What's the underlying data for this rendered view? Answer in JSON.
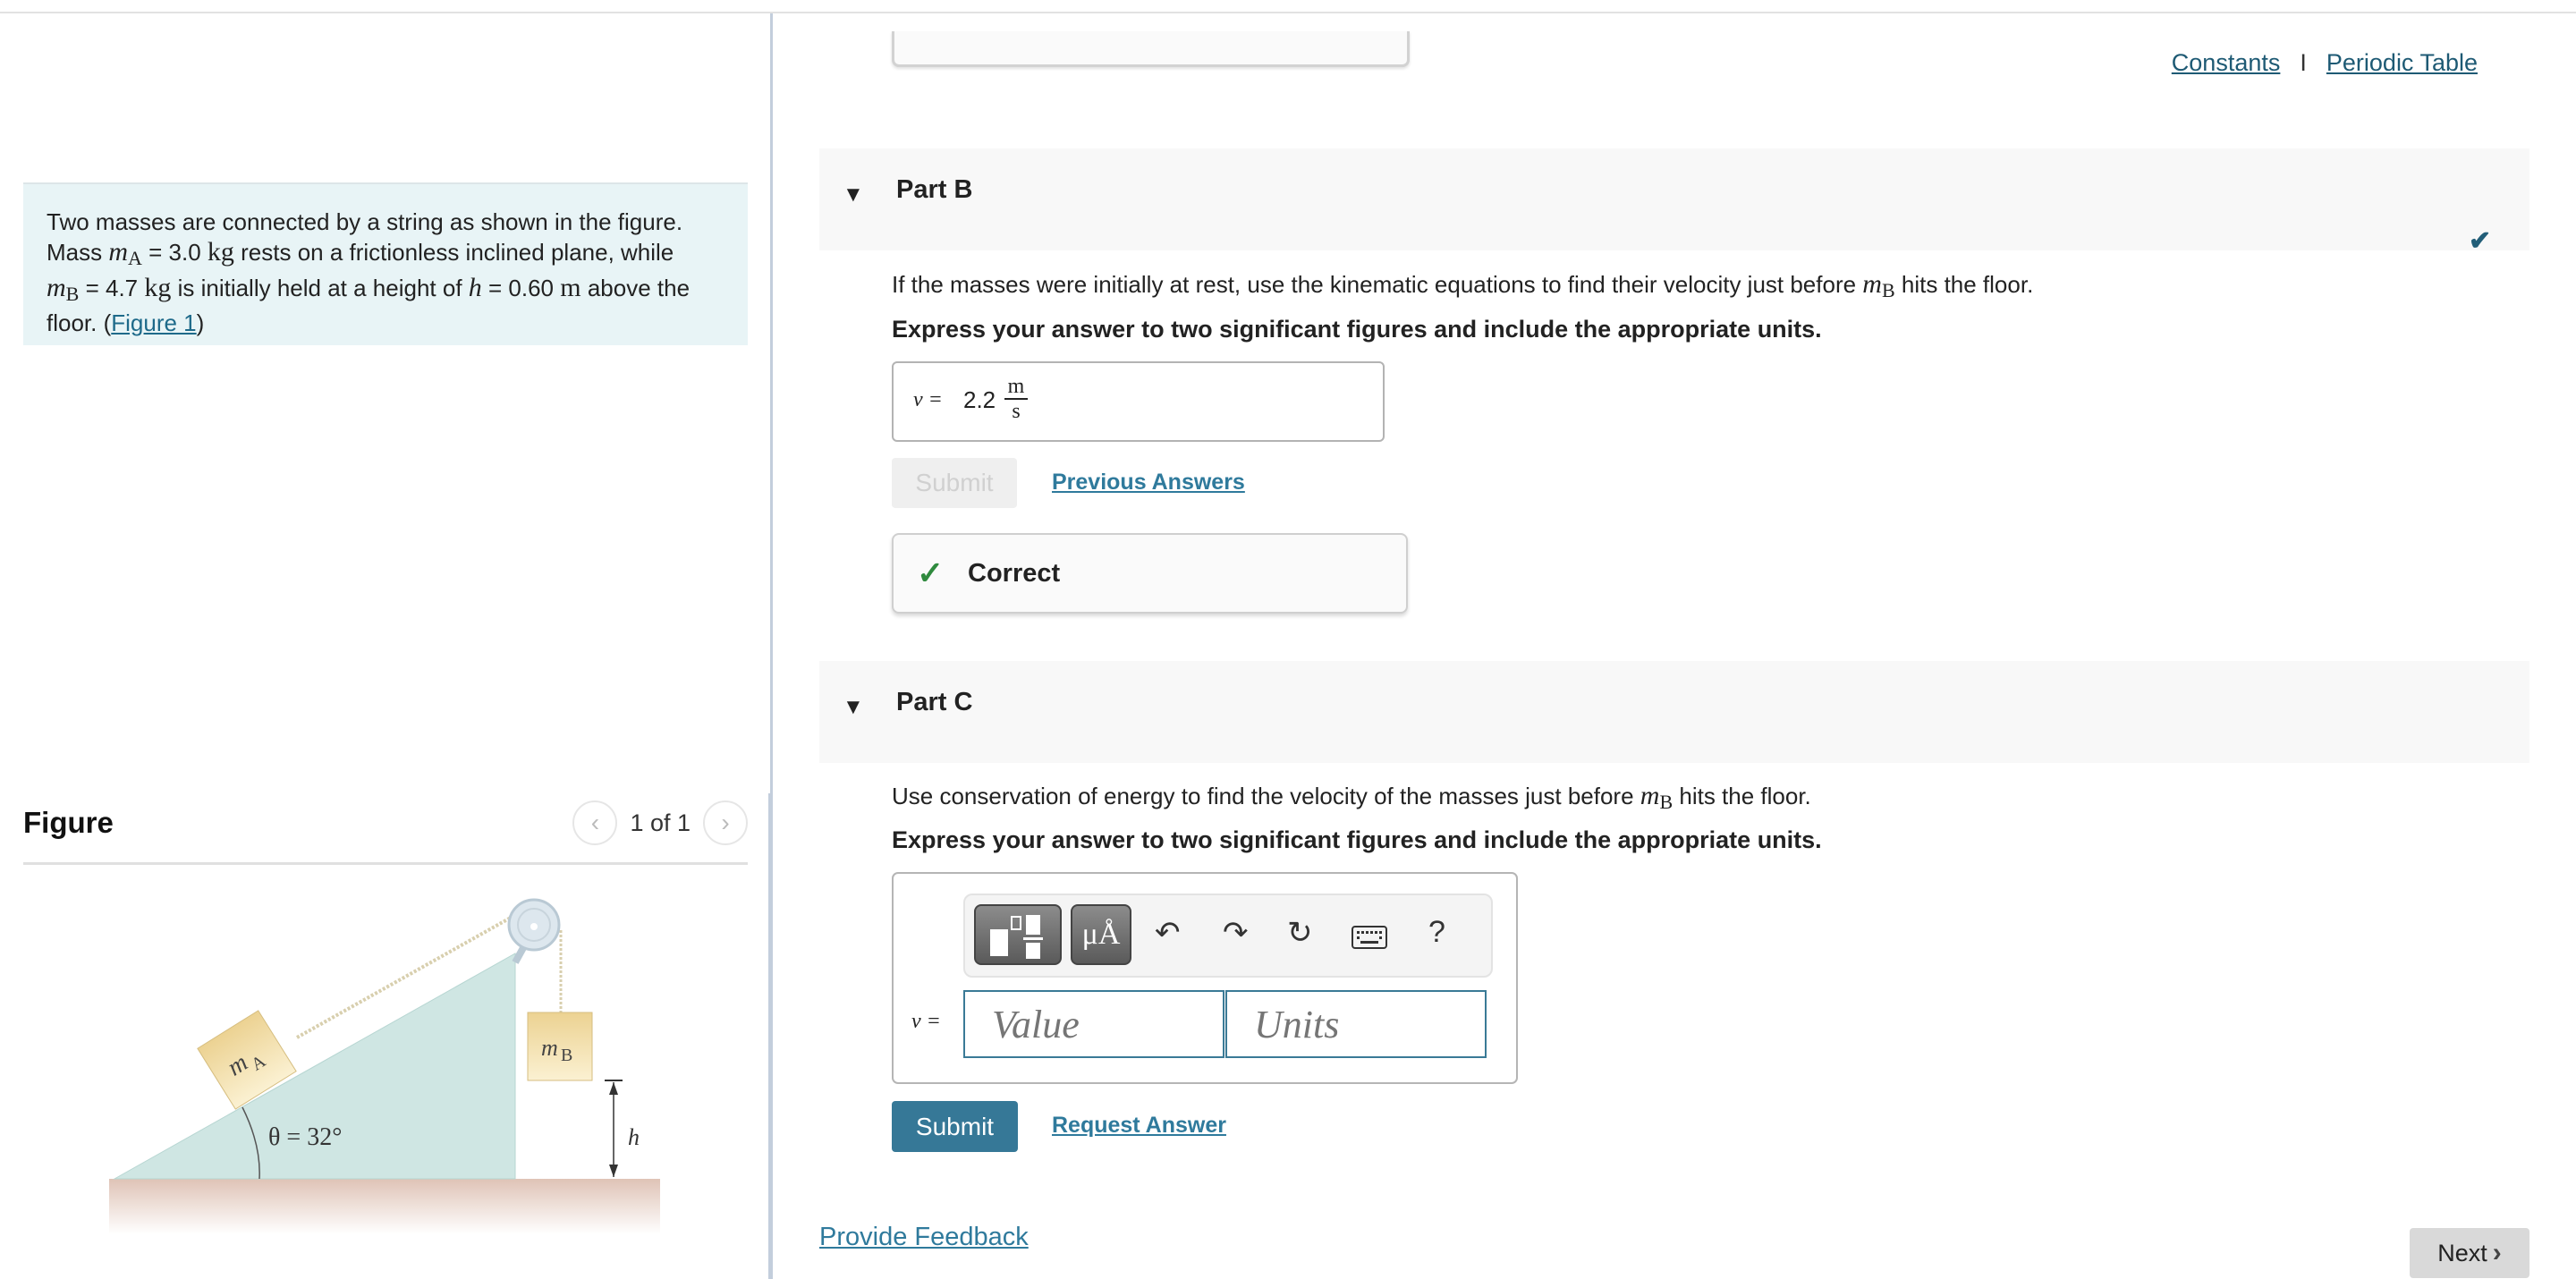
{
  "problem": {
    "intro": "Two masses are connected by a string as shown in the figure.",
    "line2_prefix": "Mass ",
    "mA_symbol": "m",
    "mA_sub": "A",
    "mA_eq": " = 3.0 ",
    "mA_unit": "kg",
    "line2_suffix": " rests on a frictionless inclined plane, while",
    "mB_symbol": "m",
    "mB_sub": "B",
    "mB_eq": " = 4.7 ",
    "mB_unit": "kg",
    "line3_mid": " is initially held at a height of ",
    "h_symbol": "h",
    "h_eq": " = 0.60 ",
    "h_unit": "m",
    "line3_suffix": " above the",
    "line4_prefix": "floor. (",
    "figure_link": "Figure 1",
    "line4_suffix": ")"
  },
  "figure": {
    "title": "Figure",
    "counter": "1 of 1",
    "prev_icon": "chevron-left-icon",
    "next_icon": "chevron-right-icon",
    "label_mA": "m",
    "label_mA_sub": "A",
    "label_mB": "m",
    "label_mB_sub": "B",
    "angle_label": "θ = 32°",
    "height_label": "h",
    "colors": {
      "incline": "#cfe6e3",
      "block": "#f0dba0",
      "floor": "#dfc3b6",
      "pulley": "#dde7ee"
    }
  },
  "header_links": {
    "constants": "Constants",
    "separator": "I",
    "periodic_table": "Periodic Table"
  },
  "part_b": {
    "title": "Part B",
    "question_prefix": "If the masses were initially at rest, use the kinematic equations to find their velocity just before ",
    "question_sym": "m",
    "question_sub": "B",
    "question_suffix": " hits the floor.",
    "instruction": "Express your answer to two significant figures and include the appropriate units.",
    "answer_label": "v =",
    "answer_value": "2.2",
    "answer_unit_num": "m",
    "answer_unit_den": "s",
    "submit_label": "Submit",
    "previous_answers_label": "Previous Answers",
    "feedback_label": "Correct",
    "status": "completed"
  },
  "part_c": {
    "title": "Part C",
    "question_prefix": "Use conservation of energy to find the velocity of the masses just before ",
    "question_sym": "m",
    "question_sub": "B",
    "question_suffix": " hits the floor.",
    "instruction": "Express your answer to two significant figures and include the appropriate units.",
    "answer_label": "v =",
    "value_placeholder": "Value",
    "units_placeholder": "Units",
    "units_symbol_button": "μÅ",
    "help_label": "?",
    "submit_label": "Submit",
    "request_answer_label": "Request Answer"
  },
  "footer": {
    "provide_feedback": "Provide Feedback",
    "next_label": "Next"
  },
  "colors": {
    "link": "#1e6a8a",
    "primary_button": "#367897",
    "correct_green": "#2f8a3e",
    "problem_bg": "#e8f4f6",
    "part_header_bg": "#f8f8f8"
  }
}
